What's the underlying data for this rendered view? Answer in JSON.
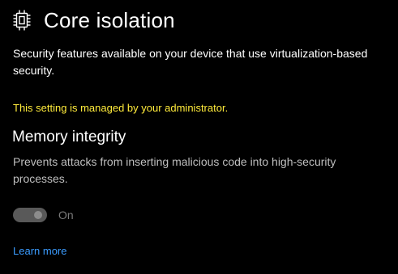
{
  "header": {
    "icon": "chip-icon",
    "title": "Core isolation"
  },
  "description": "Security features available on your device that use virtualization-based security.",
  "admin_note": "This setting is managed by your administrator.",
  "memory_integrity": {
    "title": "Memory integrity",
    "description": "Prevents attacks from inserting malicious code into high-security processes.",
    "toggle": {
      "state": "on",
      "disabled": true,
      "label": "On"
    }
  },
  "learn_more": "Learn more",
  "colors": {
    "background": "#000000",
    "text": "#ffffff",
    "admin_note": "#ffeb3b",
    "link": "#3b9cff",
    "toggle_disabled": "#595959"
  }
}
